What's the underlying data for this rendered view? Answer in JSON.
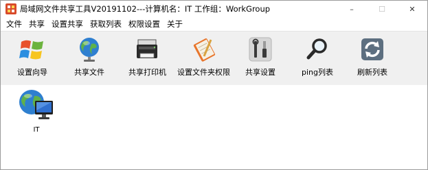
{
  "window": {
    "title": "局域网文件共享工具V20191102---计算机名：IT  工作组：WorkGroup",
    "icon": "app-logo-icon",
    "controls": {
      "minimize": "–",
      "maximize": "☐",
      "close": "✕"
    }
  },
  "menu": {
    "items": [
      "文件",
      "共享",
      "设置共享",
      "获取列表",
      "权限设置",
      "关于"
    ]
  },
  "toolbar": {
    "items": [
      {
        "label": "设置向导",
        "icon": "windows-logo-icon"
      },
      {
        "label": "共享文件",
        "icon": "globe-icon"
      },
      {
        "label": "共享打印机",
        "icon": "printer-icon"
      },
      {
        "label": "设置文件夹权限",
        "icon": "notebook-pencil-icon"
      },
      {
        "label": "共享设置",
        "icon": "tools-icon"
      },
      {
        "label": "ping列表",
        "icon": "magnifier-icon"
      },
      {
        "label": "刷新列表",
        "icon": "refresh-icon"
      }
    ]
  },
  "computers": [
    {
      "name": "IT",
      "icon": "networked-computer-icon"
    }
  ],
  "colors": {
    "toolbar_bg": "#f0f0f0",
    "app_icon_bg": "#d84a2a"
  }
}
